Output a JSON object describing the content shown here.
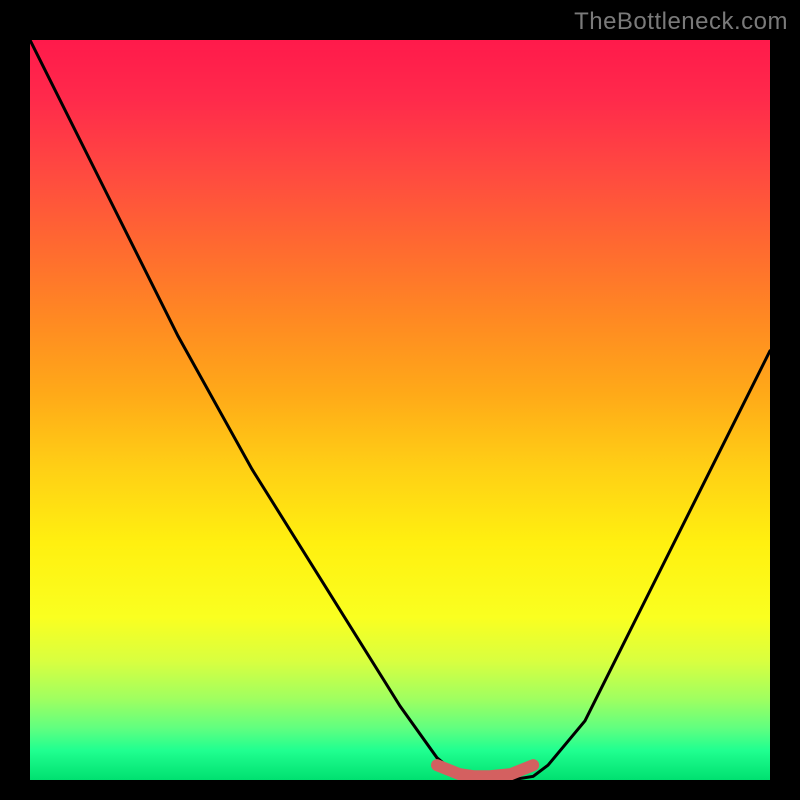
{
  "watermark": "TheBottleneck.com",
  "chart_data": {
    "type": "line",
    "title": "",
    "xlabel": "",
    "ylabel": "",
    "xlim": [
      0,
      100
    ],
    "ylim": [
      0,
      100
    ],
    "series": [
      {
        "name": "curve",
        "x": [
          0,
          10,
          20,
          30,
          40,
          50,
          55,
          58,
          60,
          62,
          65,
          68,
          70,
          75,
          80,
          90,
          100
        ],
        "y": [
          100,
          80,
          60,
          42,
          26,
          10,
          3,
          0.5,
          0,
          0,
          0,
          0.5,
          2,
          8,
          18,
          38,
          58
        ]
      }
    ],
    "highlight": {
      "name": "bottom-flat",
      "x": [
        55,
        58,
        60,
        62,
        65,
        68
      ],
      "y": [
        2,
        0.8,
        0.5,
        0.5,
        0.8,
        2
      ],
      "color": "#d46060"
    }
  }
}
